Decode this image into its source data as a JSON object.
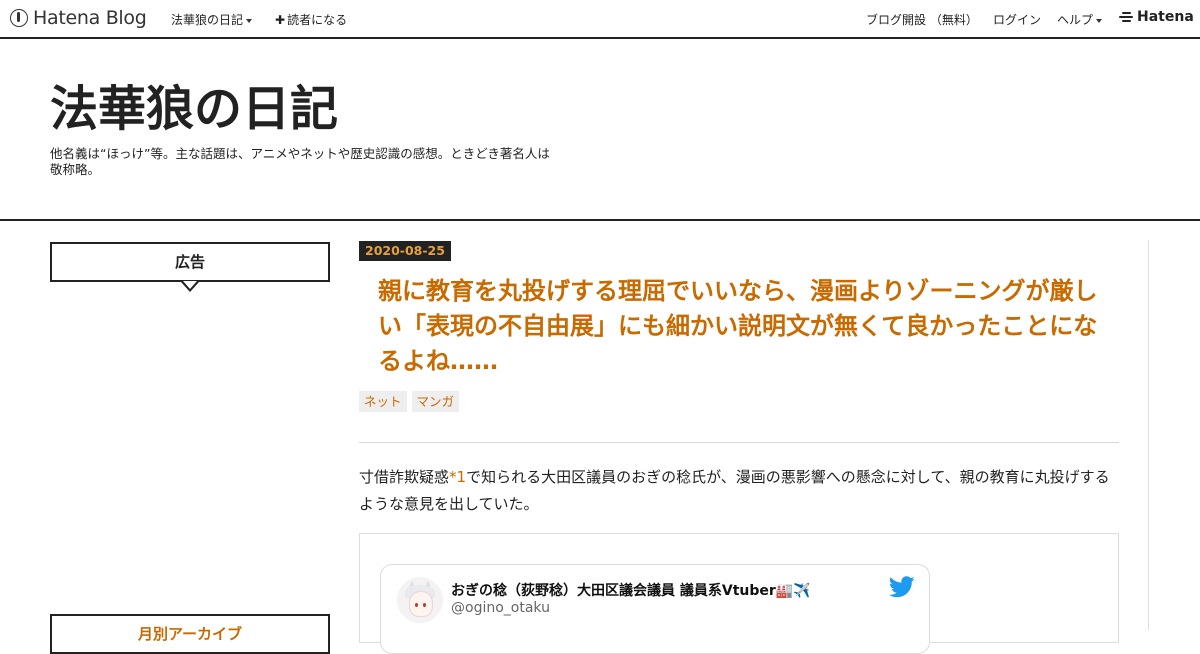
{
  "globalheader": {
    "logo_text": "Hatena Blog",
    "blog_menu_label": "法華狼の日記",
    "subscribe_label": "読者になる",
    "start_blog_label": "ブログ開設 （無料）",
    "login_label": "ログイン",
    "help_label": "ヘルプ",
    "brand_label": "Hatena"
  },
  "blog": {
    "title": "法華狼の日記",
    "description": "他名義は“ほっけ”等。主な話題は、アニメやネットや歴史認識の感想。ときどき著名人は敬称略。"
  },
  "sidebar": {
    "ad_title": "広告",
    "archive_title": "月別アーカイブ"
  },
  "entry": {
    "date": "2020-08-25",
    "title": "親に教育を丸投げする理屈でいいなら、漫画よりゾーニングが厳しい「表現の不自由展」にも細かい説明文が無くて良かったことになるよね……",
    "tags": [
      "ネット",
      "マンガ"
    ],
    "body_before_note": "寸借詐欺疑惑",
    "footnote": "*1",
    "body_after_note": "で知られる大田区議員のおぎの稔氏が、漫画の悪影響への懸念に対して、親の教育に丸投げするような意見を出していた。"
  },
  "tweet": {
    "display_name": "おぎの稔（荻野稔）大田区議会議員 議員系Vtuber🏭✈️",
    "handle": "@ogino_otaku"
  },
  "colors": {
    "accent": "#c86a00",
    "date_text": "#e8a13a",
    "twitter_blue": "#1d9bf0"
  }
}
